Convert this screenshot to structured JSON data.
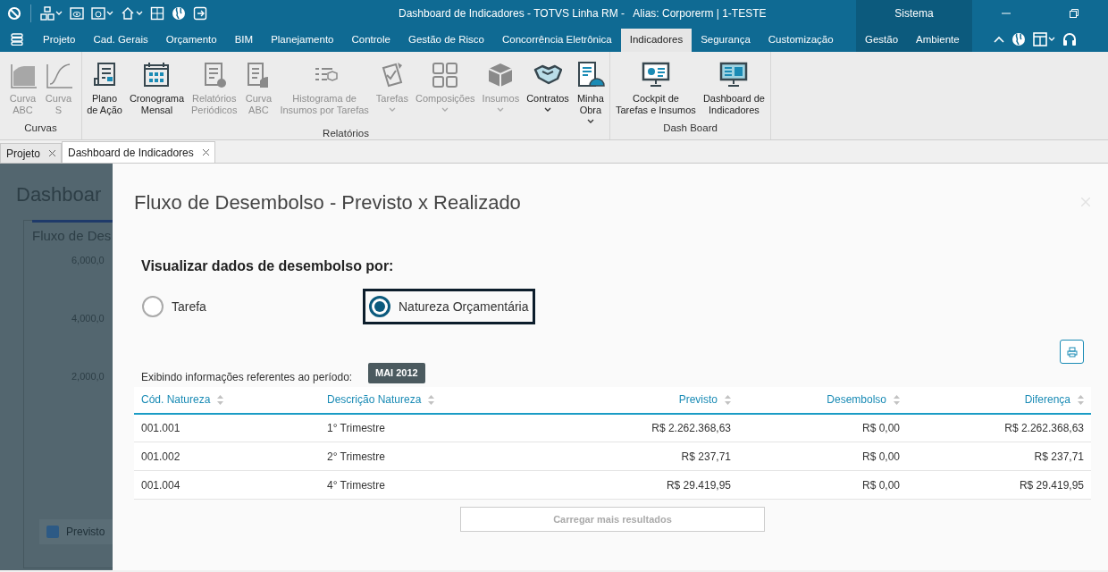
{
  "window": {
    "title": "Dashboard de Indicadores - TOTVS Linha RM -   Alias: Corporerm | 1-TESTE",
    "section": "Sistema"
  },
  "menu_tabs": [
    {
      "label": "Projeto",
      "selected": false
    },
    {
      "label": "Cad. Gerais",
      "selected": false
    },
    {
      "label": "Orçamento",
      "selected": false
    },
    {
      "label": "BIM",
      "selected": false
    },
    {
      "label": "Planejamento",
      "selected": false
    },
    {
      "label": "Controle",
      "selected": false
    },
    {
      "label": "Gestão de Risco",
      "selected": false
    },
    {
      "label": "Concorrência Eletrônica",
      "selected": false
    },
    {
      "label": "Indicadores",
      "selected": true
    },
    {
      "label": "Segurança",
      "selected": false
    },
    {
      "label": "Customização",
      "selected": false
    }
  ],
  "system_tabs": [
    {
      "label": "Gestão"
    },
    {
      "label": "Ambiente"
    }
  ],
  "ribbon": {
    "groups": [
      {
        "title": "Curvas",
        "items": [
          {
            "label": "Curva\nABC",
            "disabled": true,
            "dropdown": false
          },
          {
            "label": "Curva\nS",
            "disabled": true,
            "dropdown": false
          }
        ]
      },
      {
        "title": "Relatórios",
        "items": [
          {
            "label": "Plano\nde Ação",
            "disabled": false,
            "dropdown": false
          },
          {
            "label": "Cronograma\nMensal",
            "disabled": false,
            "dropdown": false
          },
          {
            "label": "Relatórios\nPeriódicos",
            "disabled": true,
            "dropdown": false
          },
          {
            "label": "Curva\nABC",
            "disabled": true,
            "dropdown": false
          },
          {
            "label": "Histograma de\nInsumos por Tarefas",
            "disabled": true,
            "dropdown": false
          },
          {
            "label": "Tarefas",
            "disabled": true,
            "dropdown": true
          },
          {
            "label": "Composições",
            "disabled": true,
            "dropdown": true
          },
          {
            "label": "Insumos",
            "disabled": true,
            "dropdown": true
          },
          {
            "label": "Contratos",
            "disabled": false,
            "dropdown": true
          },
          {
            "label": "Minha\nObra",
            "disabled": false,
            "dropdown": true
          }
        ]
      },
      {
        "title": "Dash Board",
        "items": [
          {
            "label": "Cockpit de\nTarefas e Insumos",
            "disabled": false,
            "dropdown": false
          },
          {
            "label": "Dashboard de\nIndicadores",
            "disabled": false,
            "dropdown": false
          }
        ]
      }
    ]
  },
  "doc_tabs": [
    {
      "label": "Projeto",
      "selected": false
    },
    {
      "label": "Dashboard de Indicadores",
      "selected": true
    }
  ],
  "background_dashboard": {
    "title": "Dashboar",
    "chart_title": "Fluxo de Des",
    "axis_labels": [
      "6,000,0",
      "4,000,0",
      "2,000,0"
    ],
    "legend": "Previsto"
  },
  "modal": {
    "title": "Fluxo de Desembolso - Previsto x Realizado",
    "question": "Visualizar dados de desembolso por:",
    "options": [
      {
        "label": "Tarefa",
        "selected": false
      },
      {
        "label": "Natureza Orçamentária",
        "selected": true
      }
    ],
    "period_label": "Exibindo informações referentes ao período:",
    "period": "MAI 2012",
    "table": {
      "columns": [
        "Cód. Natureza",
        "Descrição Natureza",
        "Previsto",
        "Desembolso",
        "Diferença"
      ],
      "rows": [
        [
          "001.001",
          "1° Trimestre",
          "R$ 2.262.368,63",
          "R$ 0,00",
          "R$ 2.262.368,63"
        ],
        [
          "001.002",
          "2° Trimestre",
          "R$ 237,71",
          "R$ 0,00",
          "R$ 237,71"
        ],
        [
          "001.004",
          "4° Trimestre",
          "R$ 29.419,95",
          "R$ 0,00",
          "R$ 29.419,95"
        ]
      ]
    },
    "load_more": "Carregar mais resultados"
  }
}
